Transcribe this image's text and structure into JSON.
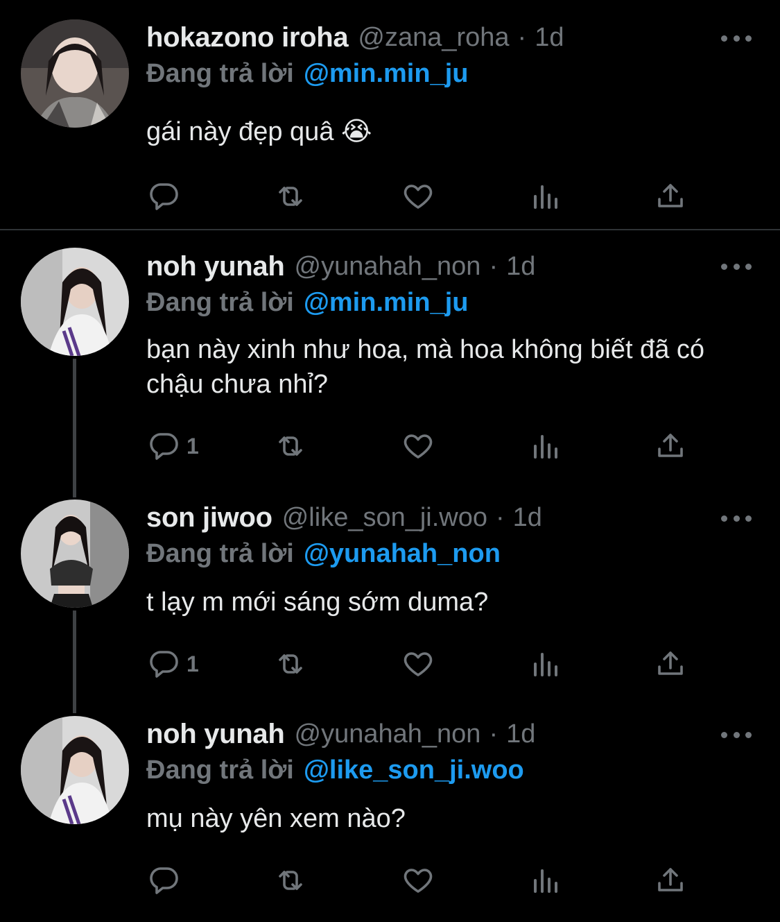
{
  "tweets": [
    {
      "name": "hokazono iroha",
      "handle": "@zana_roha",
      "dot": "·",
      "time": "1d",
      "reply_prefix": "Đang trả lời",
      "reply_to": "@min.min_ju",
      "text": "gái này đẹp quâ 😭",
      "reply_count": ""
    },
    {
      "name": "noh yunah",
      "handle": "@yunahah_non",
      "dot": "·",
      "time": "1d",
      "reply_prefix": "Đang trả lời",
      "reply_to": "@min.min_ju",
      "text": "bạn này xinh như hoa, mà hoa không biết đã có chậu chưa nhỉ?",
      "reply_count": "1"
    },
    {
      "name": "son jiwoo",
      "handle": "@like_son_ji.woo",
      "dot": "·",
      "time": "1d",
      "reply_prefix": "Đang trả lời",
      "reply_to": "@yunahah_non",
      "text": "t lạy m mới sáng sớm duma?",
      "reply_count": "1"
    },
    {
      "name": "noh yunah",
      "handle": "@yunahah_non",
      "dot": "·",
      "time": "1d",
      "reply_prefix": "Đang trả lời",
      "reply_to": "@like_son_ji.woo",
      "text": "mụ này yên xem nào?",
      "reply_count": ""
    }
  ],
  "icons": [
    "reply-icon",
    "retweet-icon",
    "like-icon",
    "analytics-icon",
    "share-icon",
    "more-icon"
  ],
  "colors": {
    "background": "#000000",
    "text": "#e7e9ea",
    "muted": "#71767b",
    "link": "#1d9bf0",
    "divider": "#2f3336"
  }
}
